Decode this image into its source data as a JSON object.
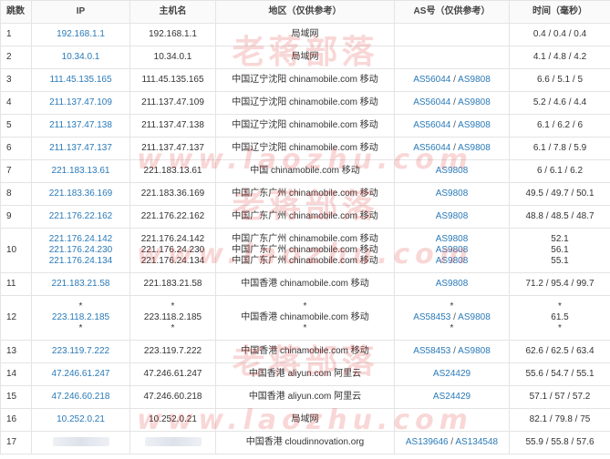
{
  "headers": [
    "跳数",
    "IP",
    "主机名",
    "地区（仅供参考）",
    "AS号（仅供参考）",
    "时间（毫秒）"
  ],
  "rows": [
    {
      "hop": "1",
      "ips": [
        "192.168.1.1"
      ],
      "hosts": [
        "192.168.1.1"
      ],
      "region": "局域网",
      "as": [],
      "times": [
        "0.4 / 0.4 / 0.4"
      ]
    },
    {
      "hop": "2",
      "ips": [
        "10.34.0.1"
      ],
      "hosts": [
        "10.34.0.1"
      ],
      "region": "局域网",
      "as": [],
      "times": [
        "4.1 / 4.8 / 4.2"
      ]
    },
    {
      "hop": "3",
      "ips": [
        "111.45.135.165"
      ],
      "hosts": [
        "111.45.135.165"
      ],
      "region": "中国辽宁沈阳 chinamobile.com 移动",
      "as": [
        [
          "AS56044",
          "AS9808"
        ]
      ],
      "times": [
        "6.6 / 5.1 / 5"
      ]
    },
    {
      "hop": "4",
      "ips": [
        "211.137.47.109"
      ],
      "hosts": [
        "211.137.47.109"
      ],
      "region": "中国辽宁沈阳 chinamobile.com 移动",
      "as": [
        [
          "AS56044",
          "AS9808"
        ]
      ],
      "times": [
        "5.2 / 4.6 / 4.4"
      ]
    },
    {
      "hop": "5",
      "ips": [
        "211.137.47.138"
      ],
      "hosts": [
        "211.137.47.138"
      ],
      "region": "中国辽宁沈阳 chinamobile.com 移动",
      "as": [
        [
          "AS56044",
          "AS9808"
        ]
      ],
      "times": [
        "6.1 / 6.2 / 6"
      ]
    },
    {
      "hop": "6",
      "ips": [
        "211.137.47.137"
      ],
      "hosts": [
        "211.137.47.137"
      ],
      "region": "中国辽宁沈阳 chinamobile.com 移动",
      "as": [
        [
          "AS56044",
          "AS9808"
        ]
      ],
      "times": [
        "6.1 / 7.8 / 5.9"
      ]
    },
    {
      "hop": "7",
      "ips": [
        "221.183.13.61"
      ],
      "hosts": [
        "221.183.13.61"
      ],
      "region": "中国 chinamobile.com 移动",
      "as": [
        [
          "AS9808"
        ]
      ],
      "times": [
        "6 / 6.1 / 6.2"
      ]
    },
    {
      "hop": "8",
      "ips": [
        "221.183.36.169"
      ],
      "hosts": [
        "221.183.36.169"
      ],
      "region": "中国广东广州 chinamobile.com 移动",
      "as": [
        [
          "AS9808"
        ]
      ],
      "times": [
        "49.5 / 49.7 / 50.1"
      ]
    },
    {
      "hop": "9",
      "ips": [
        "221.176.22.162"
      ],
      "hosts": [
        "221.176.22.162"
      ],
      "region": "中国广东广州 chinamobile.com 移动",
      "as": [
        [
          "AS9808"
        ]
      ],
      "times": [
        "48.8 / 48.5 / 48.7"
      ]
    },
    {
      "hop": "10",
      "ips": [
        "221.176.24.142",
        "221.176.24.230",
        "221.176.24.134"
      ],
      "hosts": [
        "221.176.24.142",
        "221.176.24.230",
        "221.176.24.134"
      ],
      "region_lines": [
        "中国广东广州 chinamobile.com 移动",
        "中国广东广州 chinamobile.com 移动",
        "中国广东广州 chinamobile.com 移动"
      ],
      "as": [
        [
          "AS9808"
        ],
        [
          "AS9808"
        ],
        [
          "AS9808"
        ]
      ],
      "times": [
        "52.1",
        "56.1",
        "55.1"
      ]
    },
    {
      "hop": "11",
      "ips": [
        "221.183.21.58"
      ],
      "hosts": [
        "221.183.21.58"
      ],
      "region": "中国香港 chinamobile.com 移动",
      "as": [
        [
          "AS9808"
        ]
      ],
      "times": [
        "71.2 / 95.4 / 99.7"
      ]
    },
    {
      "hop": "12",
      "ips": [
        "*",
        "223.118.2.185",
        "*"
      ],
      "hosts": [
        "*",
        "223.118.2.185",
        "*"
      ],
      "region_lines": [
        "*",
        "中国香港 chinamobile.com 移动",
        "*"
      ],
      "as": [
        [
          "*"
        ],
        [
          "AS58453",
          "AS9808"
        ],
        [
          "*"
        ]
      ],
      "times": [
        "*",
        "61.5",
        "*"
      ]
    },
    {
      "hop": "13",
      "ips": [
        "223.119.7.222"
      ],
      "hosts": [
        "223.119.7.222"
      ],
      "region": "中国香港 chinamobile.com 移动",
      "as": [
        [
          "AS58453",
          "AS9808"
        ]
      ],
      "times": [
        "62.6 / 62.5 / 63.4"
      ]
    },
    {
      "hop": "14",
      "ips": [
        "47.246.61.247"
      ],
      "hosts": [
        "47.246.61.247"
      ],
      "region": "中国香港 aliyun.com 阿里云",
      "as": [
        [
          "AS24429"
        ]
      ],
      "times": [
        "55.6 / 54.7 / 55.1"
      ]
    },
    {
      "hop": "15",
      "ips": [
        "47.246.60.218"
      ],
      "hosts": [
        "47.246.60.218"
      ],
      "region": "中国香港 aliyun.com 阿里云",
      "as": [
        [
          "AS24429"
        ]
      ],
      "times": [
        "57.1 / 57 / 57.2"
      ]
    },
    {
      "hop": "16",
      "ips": [
        "10.252.0.21"
      ],
      "hosts": [
        "10.252.0.21"
      ],
      "region": "局域网",
      "as": [],
      "times": [
        "82.1 / 79.8 / 75"
      ]
    },
    {
      "hop": "17",
      "ips": [
        ""
      ],
      "hosts": [
        ""
      ],
      "redacted": true,
      "region": "中国香港 cloudinnovation.org",
      "as": [
        [
          "AS139646",
          "AS134548"
        ]
      ],
      "times": [
        "55.9 / 55.8 / 57.6"
      ]
    }
  ],
  "watermark": {
    "cn": "老蒋部落",
    "en": "www.laozhu.com"
  },
  "colors": {
    "link": "#2a7ab8",
    "border": "#e4e4e4",
    "watermark": "#e01010"
  }
}
